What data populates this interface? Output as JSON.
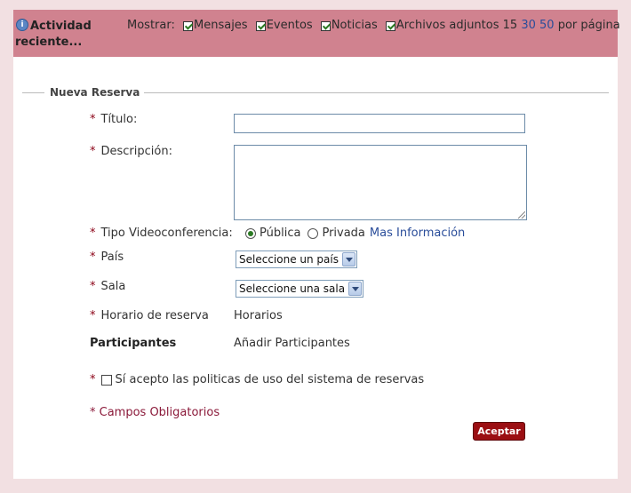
{
  "header": {
    "title": "Actividad reciente...",
    "show_label": "Mostrar:",
    "filters": [
      {
        "label": "Mensajes",
        "checked": true
      },
      {
        "label": "Eventos",
        "checked": true
      },
      {
        "label": "Noticias",
        "checked": true
      },
      {
        "label": "Archivos adjuntos",
        "checked": true
      }
    ],
    "page_sizes": {
      "current": "15",
      "options": [
        "30",
        "50"
      ],
      "suffix": "por página"
    }
  },
  "form": {
    "legend": "Nueva Reserva",
    "required_mark": "*",
    "titulo_label": "Título:",
    "titulo_value": "",
    "descripcion_label": "Descripción:",
    "descripcion_value": "",
    "tipo_label": "Tipo Videoconferencia:",
    "tipo_options": [
      {
        "label": "Pública",
        "selected": true
      },
      {
        "label": "Privada",
        "selected": false
      }
    ],
    "mas_info_link": "Mas Información",
    "pais_label": "País",
    "pais_select": "Seleccione un país",
    "sala_label": "Sala",
    "sala_select": "Seleccione una sala",
    "horario_label": "Horario de reserva",
    "horarios_link": "Horarios",
    "participantes_label": "Participantes",
    "anadir_link": "Añadir Participantes",
    "politicas_label": "Sí acepto las politicas de uso del sistema de reservas",
    "politicas_checked": false,
    "campos_obligatorios": "* Campos Obligatorios",
    "aceptar_button": "Aceptar"
  },
  "colors": {
    "header_bg": "#d0828f",
    "page_bg": "#f2e0e2",
    "required": "#8b0015",
    "link": "#2a4d9a",
    "button_bg": "#9b0f13"
  }
}
